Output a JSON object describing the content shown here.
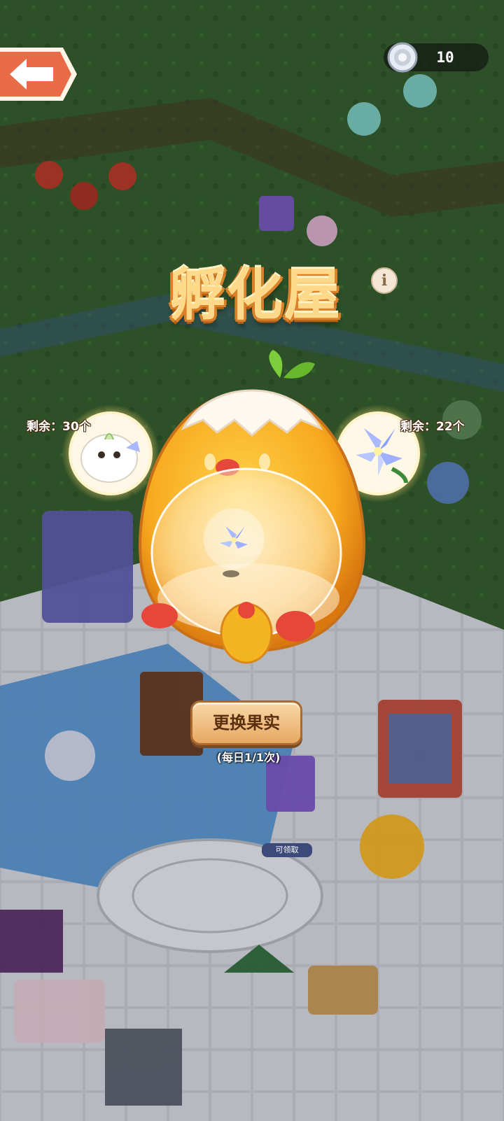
{
  "header": {
    "back_icon": "back-arrow-icon",
    "coin_icon": "silver-coin-icon",
    "coin_count": "10"
  },
  "panel": {
    "title": "孵化屋",
    "info_icon_glyph": "i",
    "left_slot": {
      "remaining_label": "剩余：30个",
      "icon": "white-fluffy-creature-icon"
    },
    "right_slot": {
      "remaining_label": "剩余：22个",
      "icon": "blue-lily-flower-icon"
    },
    "center_icon": "blue-lily-in-bubble-icon",
    "change_button_label": "更换果实",
    "daily_limit_text": "(每日1/1次)"
  },
  "background": {
    "claim_label": "可领取"
  },
  "colors": {
    "title_fill": "#ffd98a",
    "title_outline": "#d9822b",
    "button_fill": "#f0c48a",
    "button_border": "#a86a31",
    "chick_body": "#f7a91f",
    "grass": "#2f5a2c"
  }
}
